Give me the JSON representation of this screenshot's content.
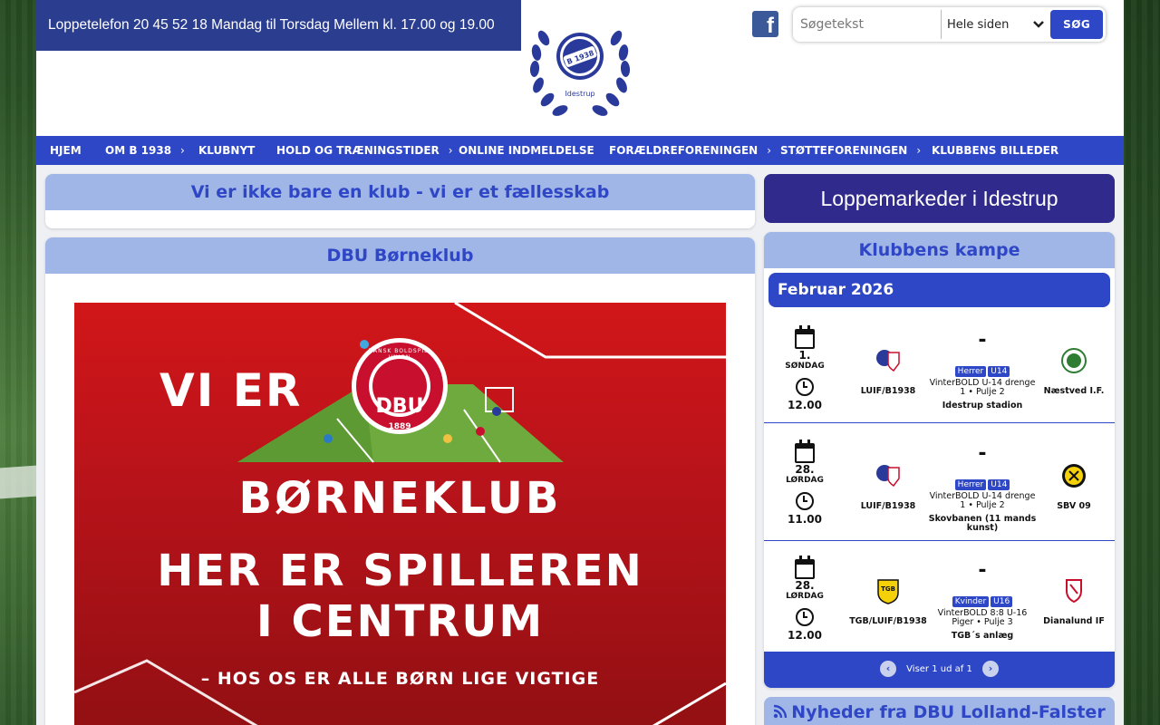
{
  "header": {
    "phone_text": "Loppetelefon 20 45 52 18 Mandag til Torsdag Mellem kl. 17.00 og 19.00",
    "logo_text": "Idestrup",
    "logo_badge": "B 1938",
    "facebook_glyph": "f",
    "search": {
      "placeholder": "Søgetekst",
      "scope": "Hele siden",
      "button": "SØG"
    }
  },
  "nav": [
    {
      "label": "HJEM",
      "has_sub": false
    },
    {
      "label": "OM B 1938",
      "has_sub": true
    },
    {
      "label": "KLUBNYT",
      "has_sub": false
    },
    {
      "label": "HOLD OG TRÆNINGSTIDER",
      "has_sub": true
    },
    {
      "label": "ONLINE INDMELDELSE",
      "has_sub": false
    },
    {
      "label": "FORÆLDREFORENINGEN",
      "has_sub": true
    },
    {
      "label": "STØTTEFORENINGEN",
      "has_sub": true
    },
    {
      "label": "KLUBBENS BILLEDER",
      "has_sub": false
    }
  ],
  "main": {
    "motto_title": "Vi er ikke bare en klub - vi er et fællesskab",
    "club_title": "DBU Børneklub",
    "banner": {
      "line1": "VI ER",
      "line2": "BØRNEKLUB",
      "line3": "HER ER SPILLEREN",
      "line4": "I CENTRUM",
      "line5": "– HOS OS ER ALLE BØRN LIGE VIGTIGE",
      "seal_text": "DBU",
      "seal_ring": "DANSK BOLDSPIL-UNION",
      "seal_year": "1889"
    }
  },
  "sidebar": {
    "loppe_button": "Loppemarkeder i Idestrup",
    "matches_title": "Klubbens kampe",
    "month": "Februar 2026",
    "matches": [
      {
        "day": "1.",
        "weekday": "SØNDAG",
        "time": "12.00",
        "home": "LUIF/B1938",
        "away": "Næstved I.F.",
        "score": "-",
        "tag1": "Herrer",
        "tag2": "U14",
        "competition": "VinterBOLD U-14 drenge 1 • Pulje 2",
        "venue": "Idestrup stadion"
      },
      {
        "day": "28.",
        "weekday": "LØRDAG",
        "time": "11.00",
        "home": "LUIF/B1938",
        "away": "SBV 09",
        "score": "-",
        "tag1": "Herrer",
        "tag2": "U14",
        "competition": "VinterBOLD U-14 drenge 1 • Pulje 2",
        "venue": "Skovbanen (11 mands kunst)"
      },
      {
        "day": "28.",
        "weekday": "LØRDAG",
        "time": "12.00",
        "home": "TGB/LUIF/B1938",
        "away": "Dianalund IF",
        "score": "-",
        "tag1": "Kvinder",
        "tag2": "U16",
        "competition": "VinterBOLD 8:8 U-16 Piger • Pulje 3",
        "venue": "TGB´s anlæg"
      }
    ],
    "pager_text": "Viser 1 ud af 1",
    "pager_prev": "‹",
    "pager_next": "›",
    "news_title": "Nyheder fra DBU Lolland-Falster"
  }
}
